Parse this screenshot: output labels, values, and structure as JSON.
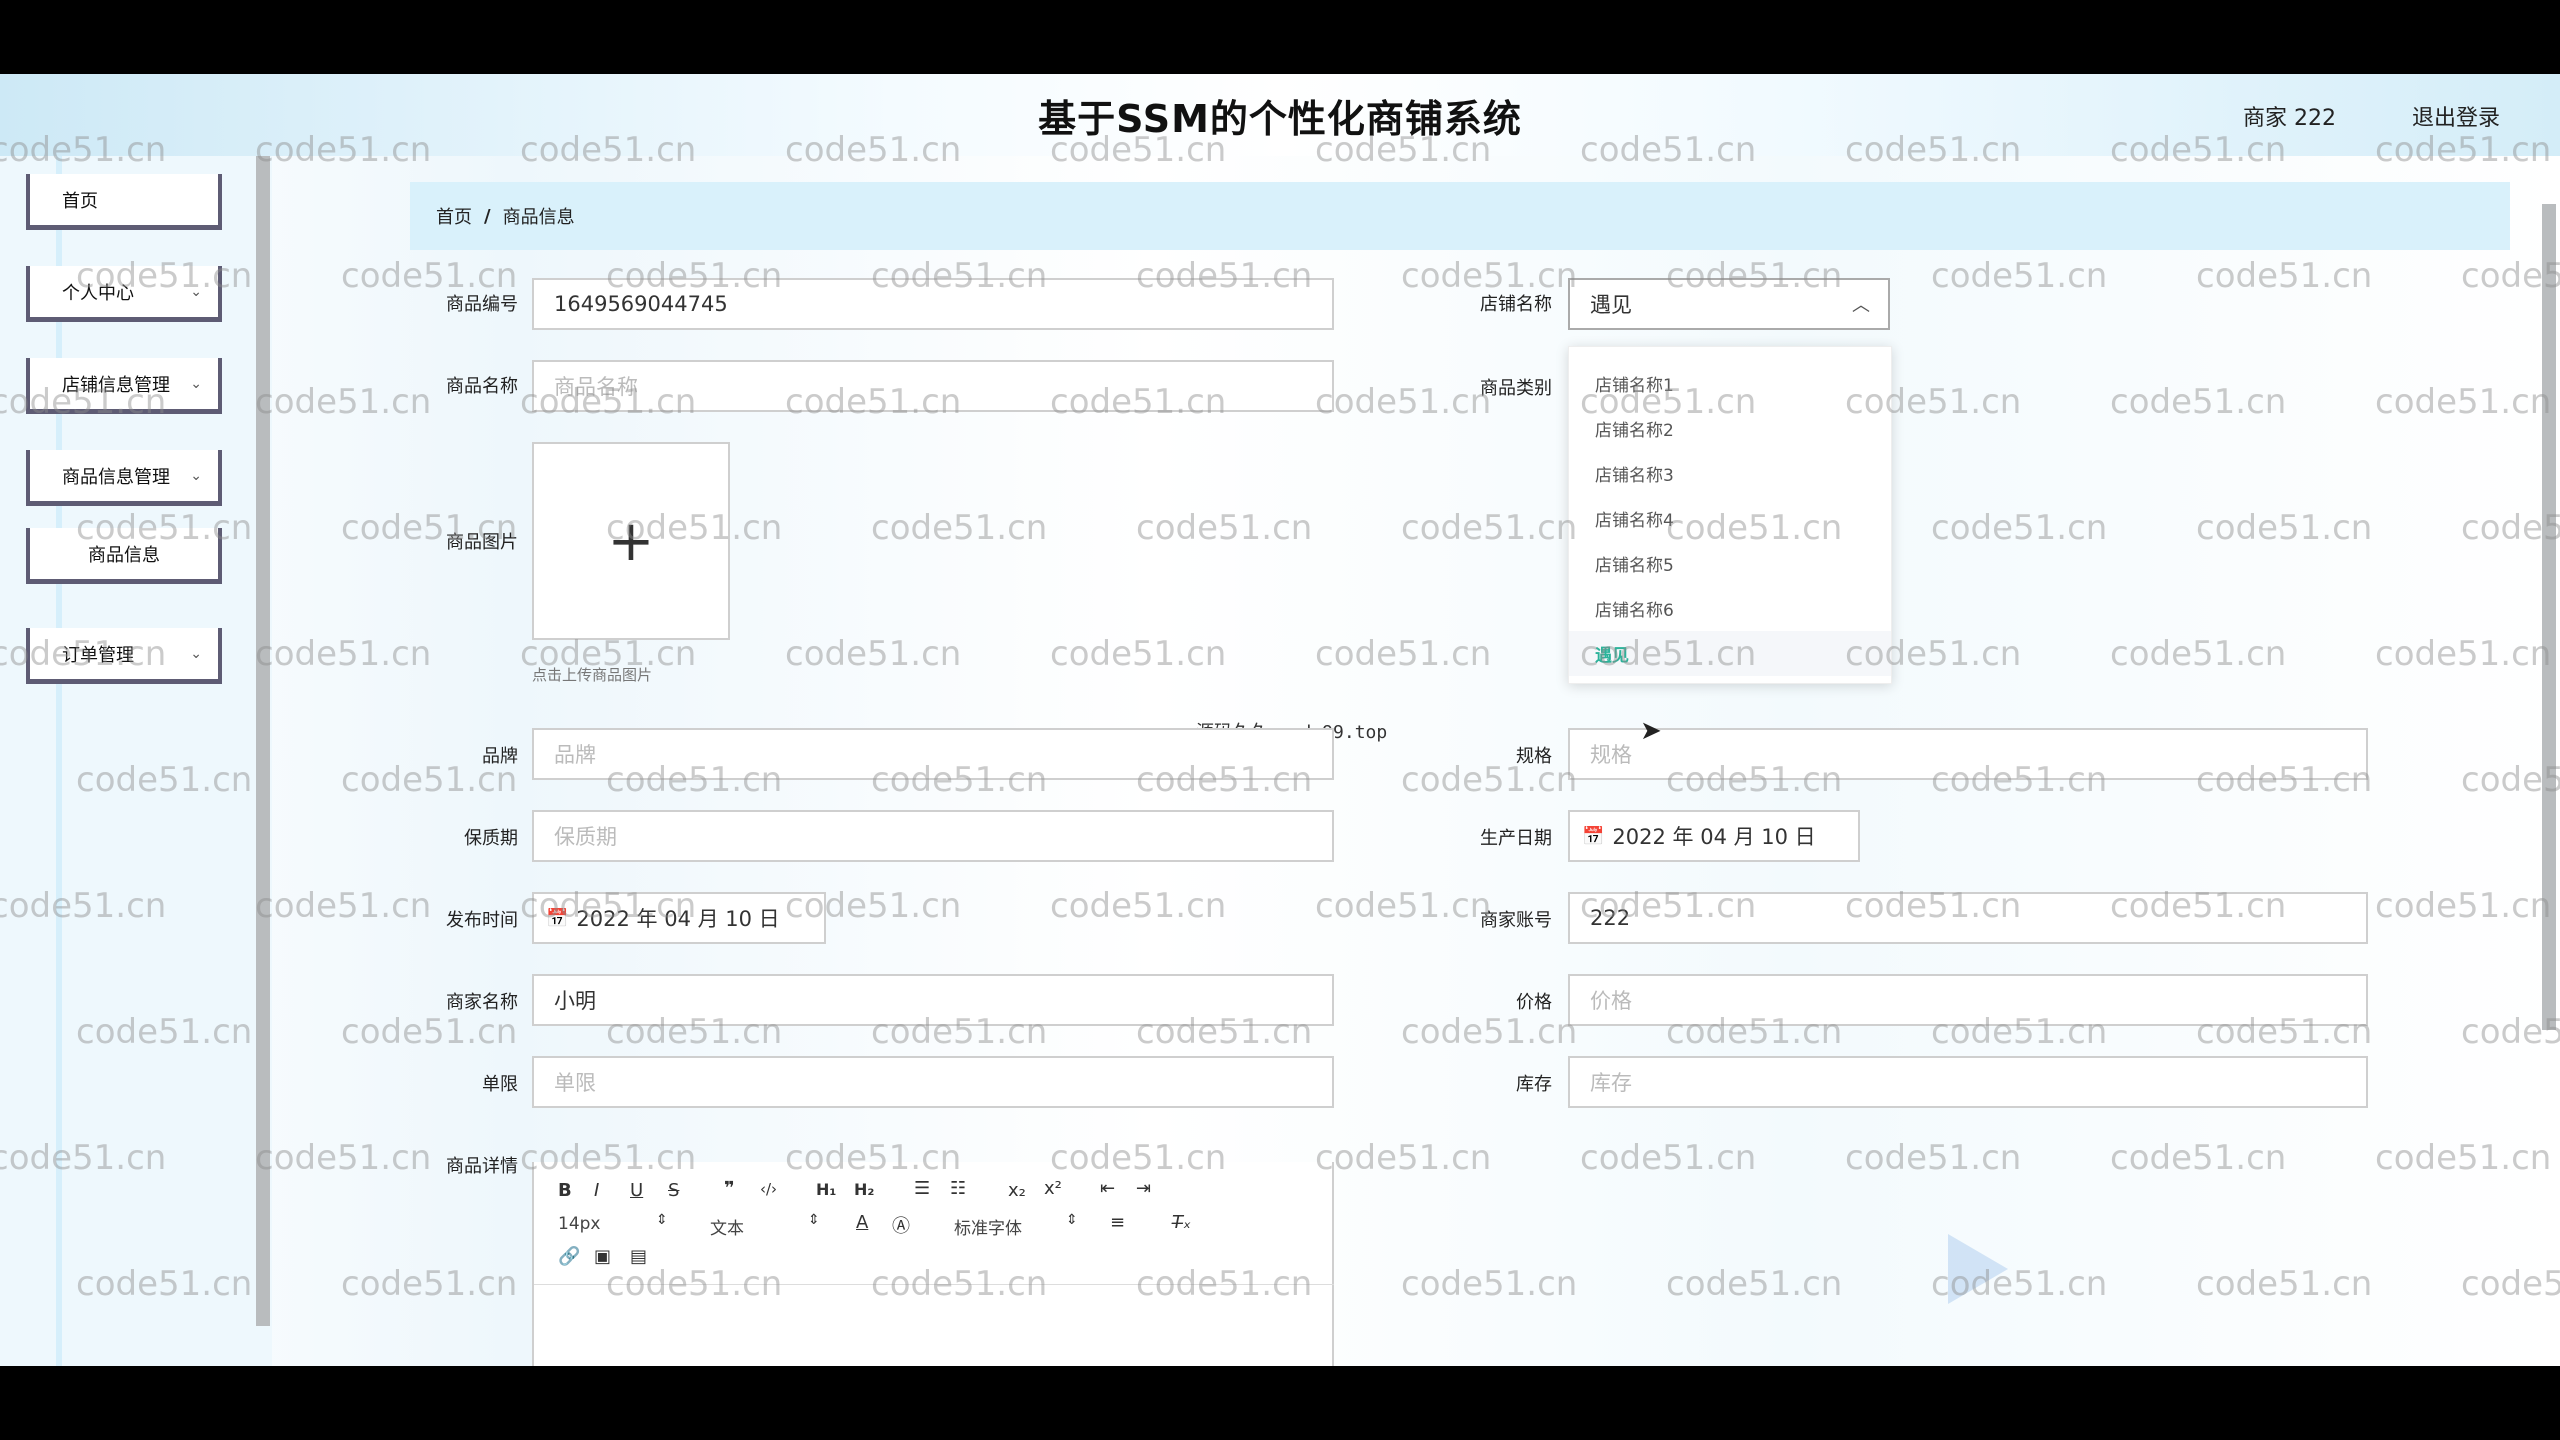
{
  "app_title": "基于SSM的个性化商铺系统",
  "user_label": "商家 222",
  "logout_label": "退出登录",
  "sidebar": {
    "items": [
      {
        "label": "首页",
        "has_arrow": false
      },
      {
        "label": "个人中心",
        "has_arrow": true
      },
      {
        "label": "店铺信息管理",
        "has_arrow": true
      },
      {
        "label": "商品信息管理",
        "has_arrow": true
      },
      {
        "label": "商品信息",
        "has_arrow": false
      },
      {
        "label": "订单管理",
        "has_arrow": true
      }
    ]
  },
  "breadcrumb": {
    "home": "首页",
    "separator": "/",
    "current": "商品信息"
  },
  "form": {
    "product_no": {
      "label": "商品编号",
      "value": "1649569044745"
    },
    "shop_name": {
      "label": "店铺名称",
      "value": "遇见"
    },
    "product_name": {
      "label": "商品名称",
      "placeholder": "商品名称"
    },
    "category": {
      "label": "商品类别"
    },
    "image": {
      "label": "商品图片",
      "hint": "点击上传商品图片"
    },
    "brand": {
      "label": "品牌",
      "placeholder": "品牌"
    },
    "spec": {
      "label": "规格",
      "placeholder": "规格"
    },
    "shelf_life": {
      "label": "保质期",
      "placeholder": "保质期"
    },
    "production_date": {
      "label": "生产日期",
      "value": "2022 年 04 月 10 日"
    },
    "publish_time": {
      "label": "发布时间",
      "value": "2022 年 04 月 10 日"
    },
    "merchant_account": {
      "label": "商家账号",
      "value": "222"
    },
    "merchant_name": {
      "label": "商家名称",
      "value": "小明"
    },
    "price": {
      "label": "价格",
      "placeholder": "价格"
    },
    "limit": {
      "label": "单限",
      "placeholder": "单限"
    },
    "stock": {
      "label": "库存",
      "placeholder": "库存"
    },
    "details": {
      "label": "商品详情"
    }
  },
  "shop_dropdown": {
    "options": [
      "店铺名称1",
      "店铺名称2",
      "店铺名称3",
      "店铺名称4",
      "店铺名称5",
      "店铺名称6",
      "遇见"
    ],
    "selected": "遇见"
  },
  "editor_toolbar": {
    "font_size": "14px",
    "format": "文本",
    "font_family": "标准字体"
  },
  "overlay_text": "源码久久-code99.top",
  "watermark": "code51.cn",
  "colors": {
    "accent": "#2bb39a",
    "breadcrumb_bg": "#d9f1fb",
    "sidebar_border": "#5e5c74"
  }
}
